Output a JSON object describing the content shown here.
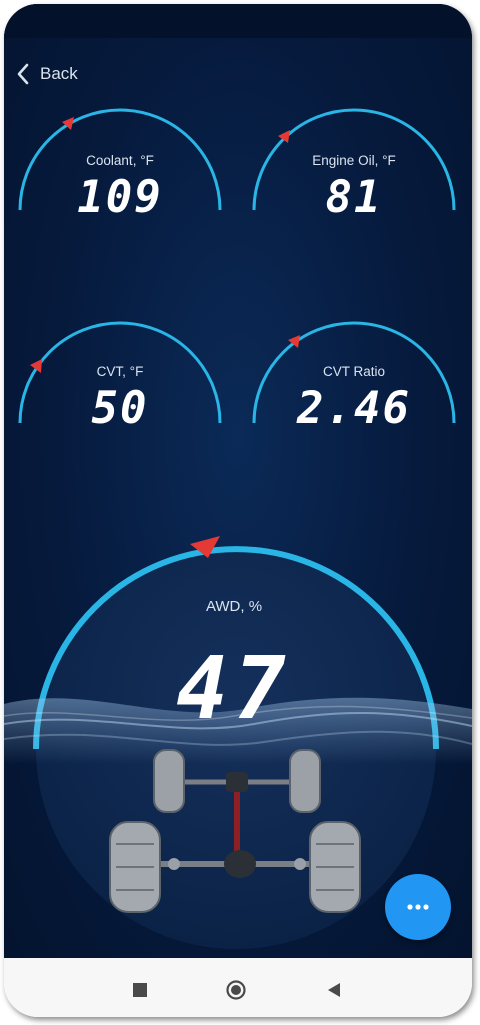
{
  "header": {
    "back_label": "Back"
  },
  "gauges": [
    {
      "label": "Coolant, °F",
      "value": "109"
    },
    {
      "label": "Engine Oil, °F",
      "value": "81"
    },
    {
      "label": "CVT, °F",
      "value": "50"
    },
    {
      "label": "CVT Ratio",
      "value": "2.46"
    }
  ],
  "awd": {
    "label": "AWD, %",
    "value": "47"
  },
  "fab": {
    "icon": "more-horizontal-icon"
  },
  "navbar": {
    "icons": [
      "recent-apps-icon",
      "home-icon",
      "back-triangle-icon"
    ]
  },
  "colors": {
    "accent": "#29b6e6",
    "indicator": "#e53935",
    "background": "#061a3d",
    "fab": "#2196f3"
  }
}
